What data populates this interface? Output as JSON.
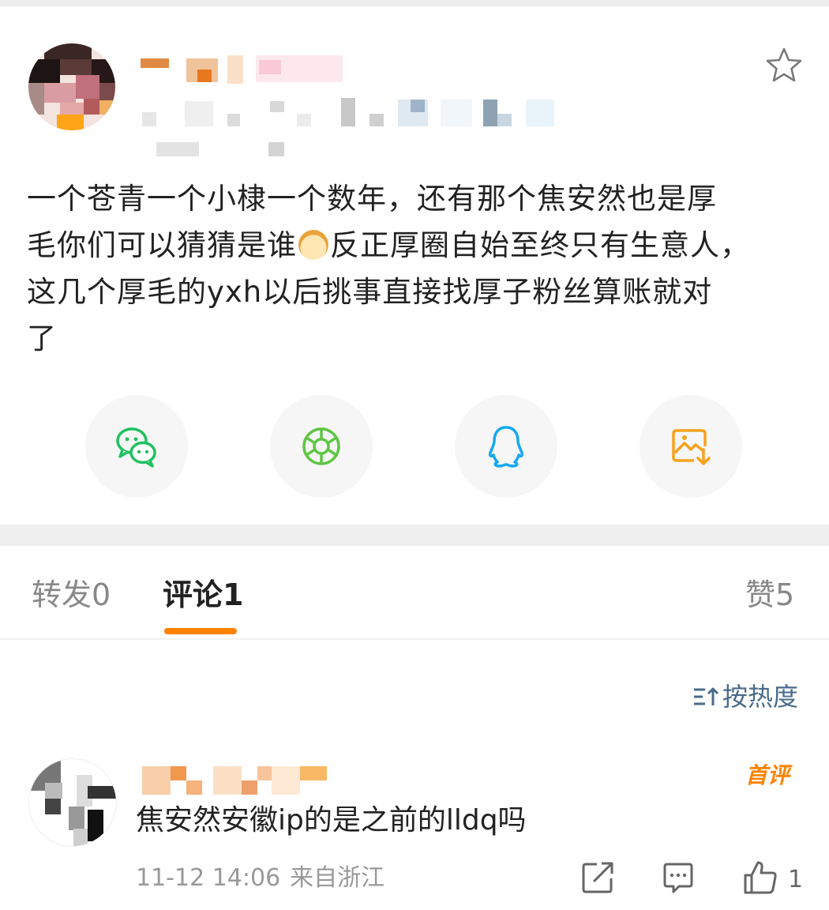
{
  "post": {
    "body_lines": [
      "一个苍青一个小棣一个数年，还有那个焦安然也是厚",
      "毛你们可以猜猜是谁",
      "反正厚圈自始至终只有生意人，",
      "这几个厚毛的yxh以后挑事直接找厚子粉丝算账就对",
      "了"
    ],
    "emoji": "doge-emoji"
  },
  "share": {
    "icons": [
      "wechat-icon",
      "moments-icon",
      "qq-icon",
      "save-image-icon"
    ],
    "colors": {
      "wechat": "#20c160",
      "moments": "#5fc543",
      "qq": "#14a8f0",
      "save": "#f7a21d"
    }
  },
  "tabs": {
    "repost": "转发",
    "repost_count": "0",
    "comment": "评论",
    "comment_count": "1",
    "like": "赞",
    "like_count": "5"
  },
  "sort": {
    "label": "按热度"
  },
  "comment": {
    "badge": "首评",
    "text": "焦安然安徽ip的是之前的lldq吗",
    "date": "11-12 14:06",
    "location": "来自浙江",
    "like_count": "1"
  },
  "colors": {
    "accent": "#ff8200",
    "link": "#4a6b8a"
  }
}
